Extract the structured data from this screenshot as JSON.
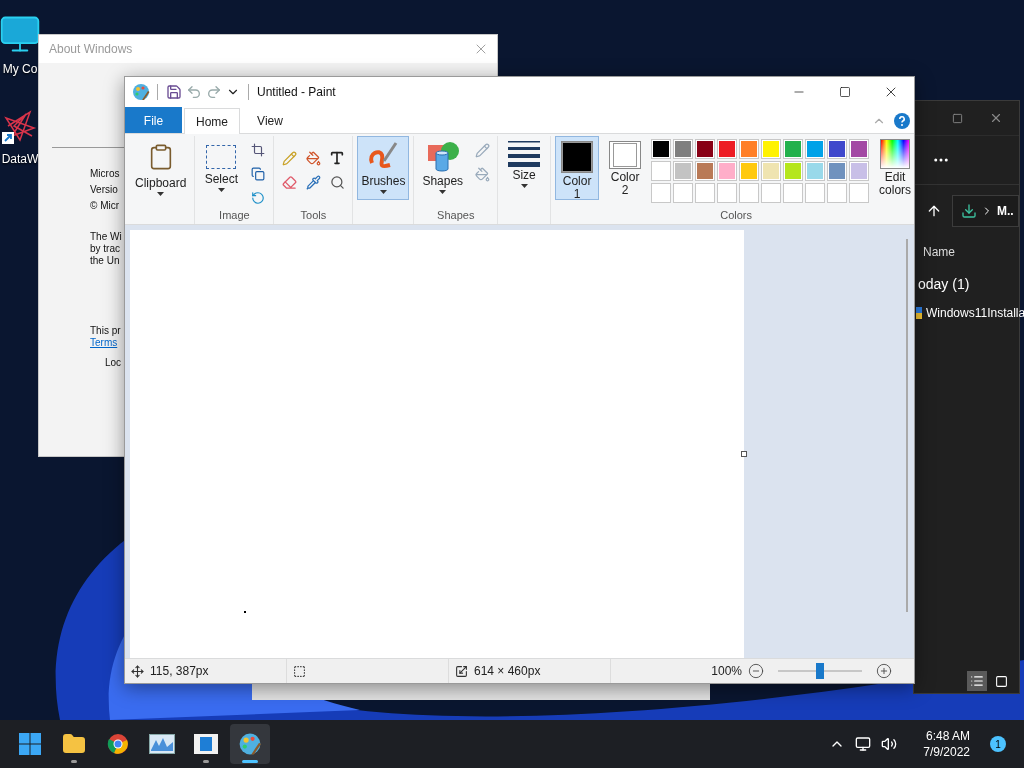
{
  "desktop_icons": [
    {
      "label": "My Co",
      "kind": "computer"
    },
    {
      "label": "DataW",
      "kind": "app"
    }
  ],
  "about_window": {
    "title": "About Windows",
    "lines": [
      "Micros",
      "Versio",
      "© Micr"
    ],
    "paragraph": [
      "The Wi",
      "by trac",
      "the Un"
    ],
    "license": "This pr",
    "link": "Terms",
    "footer": "Loc"
  },
  "explorer": {
    "path": "M..",
    "column": "Name",
    "group": "oday (1)",
    "file": "Windows11Installa"
  },
  "paint": {
    "title": "Untitled - Paint",
    "tabs": [
      {
        "label": "File",
        "kind": "file",
        "selected": false
      },
      {
        "label": "Home",
        "kind": "tab",
        "selected": true
      },
      {
        "label": "View",
        "kind": "tab",
        "selected": false
      }
    ],
    "ribbon": {
      "clipboard": "Clipboard",
      "select": "Select",
      "image_label": "Image",
      "tools_label": "Tools",
      "brushes": {
        "label": "Brushes",
        "selected": true
      },
      "shapes": "Shapes",
      "shapes_label": "Shapes",
      "size": "Size",
      "colors": {
        "slots": [
          {
            "label": "Color 1",
            "color": "#000000",
            "selected": true
          },
          {
            "label": "Color 2",
            "color": "#ffffff",
            "selected": false
          }
        ],
        "palette": [
          {
            "color": "#000000"
          },
          {
            "color": "#7f7f7f"
          },
          {
            "color": "#880015"
          },
          {
            "color": "#ed1c24"
          },
          {
            "color": "#ff7f27"
          },
          {
            "color": "#fff200"
          },
          {
            "color": "#22b14c"
          },
          {
            "color": "#00a2e8"
          },
          {
            "color": "#3f48cc"
          },
          {
            "color": "#a349a4"
          },
          {
            "color": "#ffffff"
          },
          {
            "color": "#c3c3c3"
          },
          {
            "color": "#b97a57"
          },
          {
            "color": "#ffaec9"
          },
          {
            "color": "#ffc90e"
          },
          {
            "color": "#efe4b0"
          },
          {
            "color": "#b5e61d"
          },
          {
            "color": "#99d9ea"
          },
          {
            "color": "#7092be"
          },
          {
            "color": "#c8bfe7"
          }
        ],
        "edit": "Edit colors",
        "label": "Colors"
      }
    },
    "status": {
      "position": "115, 387px",
      "dimensions": "614 × 460px",
      "zoom": "100%",
      "zoom_slider": {
        "level": 0.5
      }
    }
  },
  "taskbar": {
    "apps": [
      {
        "kind": "start",
        "selected": false,
        "running": false
      },
      {
        "kind": "folder",
        "selected": false,
        "running": true
      },
      {
        "kind": "browser",
        "selected": false,
        "running": false
      },
      {
        "kind": "monitor",
        "selected": false,
        "running": false
      },
      {
        "kind": "window",
        "selected": false,
        "running": true
      },
      {
        "kind": "paint",
        "selected": true,
        "running": true
      }
    ],
    "time": "6:48 AM",
    "date": "7/9/2022",
    "notifications": "1"
  }
}
